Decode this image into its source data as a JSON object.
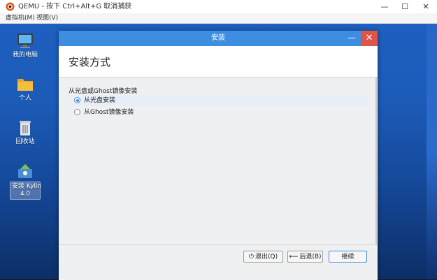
{
  "qemu": {
    "title": "QEMU - 按下 Ctrl+Alt+G 取消捕获",
    "menu": [
      "虚拟机(M)",
      "视图(V)"
    ],
    "controls": {
      "minimize": "—",
      "maximize": "☐",
      "close": "✕"
    }
  },
  "desktop": {
    "icons": [
      {
        "label": "我的电脑",
        "icon": "computer-icon"
      },
      {
        "label": "个人",
        "icon": "folder-icon"
      },
      {
        "label": "回收站",
        "icon": "trash-icon"
      },
      {
        "label_line1": "安装 Kylin",
        "label_line2": "4.0",
        "icon": "installer-icon",
        "selected": true
      }
    ]
  },
  "dialog": {
    "title": "安装",
    "heading": "安装方式",
    "section_label": "从光盘或Ghost镜像安装",
    "options": [
      {
        "label": "从光盘安装",
        "checked": true
      },
      {
        "label": "从Ghost镜像安装",
        "checked": false
      }
    ],
    "buttons": {
      "quit": "退出(Q)",
      "back": "后退(B)",
      "next": "继续"
    },
    "controls": {
      "minimize": "—",
      "close": "✕"
    }
  },
  "colors": {
    "accent": "#3d8ee0",
    "close": "#e0554a",
    "desktop": "#1e5fbf"
  }
}
